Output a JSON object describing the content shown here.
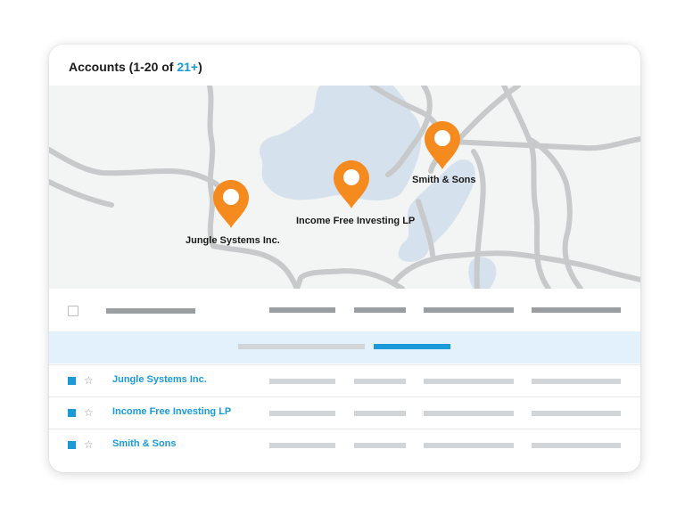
{
  "header": {
    "title_prefix": "Accounts (1-20 of ",
    "count_link": "21+",
    "title_suffix": ")"
  },
  "map": {
    "pin_color": "#f58a1f",
    "water_color": "#d5e1ec",
    "road_color": "#c8c9ca",
    "pins": [
      {
        "label": "Jungle Systems Inc.",
        "icon": "location-pin-icon"
      },
      {
        "label": "Income Free Investing LP",
        "icon": "location-pin-icon"
      },
      {
        "label": "Smith & Sons",
        "icon": "location-pin-icon"
      }
    ]
  },
  "table": {
    "accent_color": "#1a9ad9",
    "filter_bar_color": "#e2f1fb",
    "rows": [
      {
        "name": "Jungle Systems Inc.",
        "selected": true,
        "star_icon": "star-outline-icon"
      },
      {
        "name": "Income Free Investing LP",
        "selected": true,
        "star_icon": "star-outline-icon"
      },
      {
        "name": "Smith & Sons",
        "selected": true,
        "star_icon": "star-outline-icon"
      }
    ]
  }
}
